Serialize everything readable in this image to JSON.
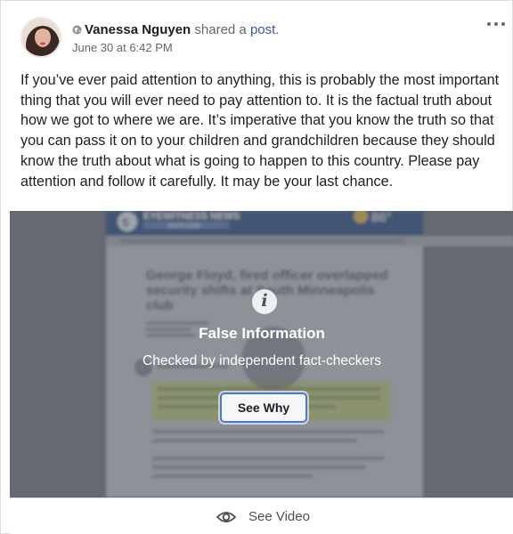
{
  "header": {
    "author": "Vanessa Nguyen",
    "shared_text": " shared a ",
    "post_link": "post",
    "period": ".",
    "timestamp": "June 30 at 6:42 PM",
    "privacy_icon": "globe-icon"
  },
  "post": {
    "text": "If you’ve ever paid attention to anything, this is probably the most important thing that you will ever need to pay attention to. It is the factual truth about how we got to where we are. It’s imperative that you know the truth so that you can pass it on to your children and grandchildren because they should know the truth about what is going to happen to this country. Please pay attention and follow it carefully. It may be your last chance."
  },
  "media": {
    "background_preview": {
      "site_name": "EYEWITNESS NEWS",
      "site_sub": "KSTP.COM",
      "temperature": "86°",
      "headline_lines": [
        "George Floyd, fired officer overlapped",
        "security shifts at South Minneapolis",
        "club"
      ]
    },
    "warning_icon": "info-icon",
    "warning_title": "False Information",
    "warning_subtitle": "Checked by independent fact-checkers",
    "see_why_label": "See Why"
  },
  "footer": {
    "icon": "eye-icon",
    "see_video_label": "See Video"
  },
  "colors": {
    "link": "#385898",
    "button_border": "#4a76d8",
    "overlay": "#464a52"
  }
}
